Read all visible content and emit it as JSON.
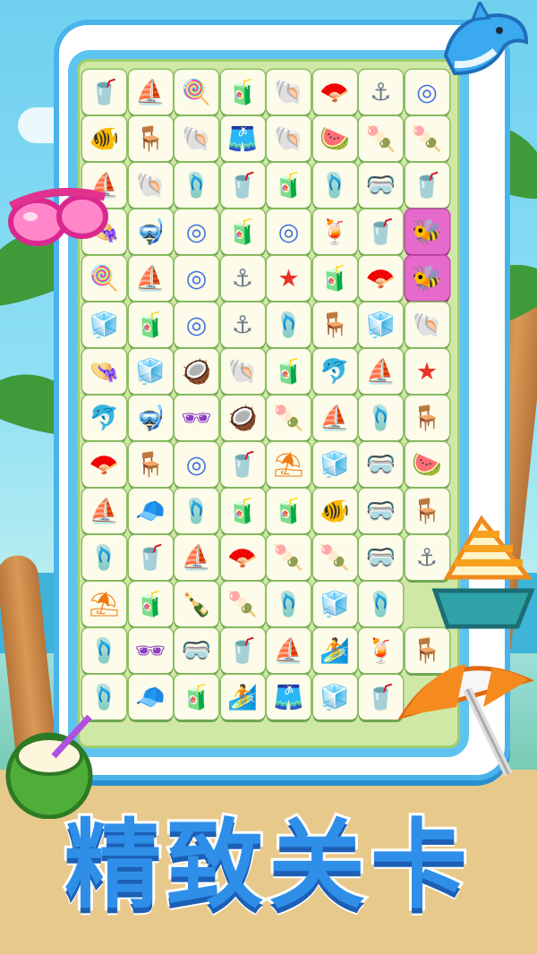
{
  "title": "精致关卡",
  "colors": {
    "board_frame": "#49b3ec",
    "board_bg": "#cfe8a6",
    "tile_bg": "#fdfbe9",
    "tile_selected": "#e56acb",
    "title_fill": "#2f8fe8"
  },
  "tiles": [
    [
      "lemonade-icon",
      "sailboat-icon",
      "candy-cane-icon",
      "juice-bottle-icon",
      "seashell-icon",
      "hand-fan-icon",
      "anchor-icon",
      "swim-ring-icon"
    ],
    [
      "tropical-fish-icon",
      "beach-chair-icon",
      "seashell-icon",
      "swim-shorts-icon",
      "seashell-icon",
      "watermelon-icon",
      "popsicle-icon",
      "popsicle-icon"
    ],
    [
      "sailboat-icon",
      "seashell-icon",
      "flip-flops-icon",
      "lemonade-icon",
      "juice-bottle-icon",
      "flip-flops-icon",
      "swim-goggles-icon",
      "lemonade-icon"
    ],
    [
      "sun-hat-icon",
      "diving-mask-icon",
      "swim-ring-icon",
      "juice-bottle-icon",
      "swim-ring-icon",
      "blue-drink-icon",
      "lemonade-icon",
      "bee-icon"
    ],
    [
      "candy-cane-icon",
      "sailboat-icon",
      "swim-ring-icon",
      "anchor-icon",
      "starfish-icon",
      "juice-bottle-icon",
      "hand-fan-icon",
      "bee-icon"
    ],
    [
      "ice-cubes-icon",
      "juice-bottle-icon",
      "swim-ring-icon",
      "anchor-icon",
      "flip-flops-icon",
      "beach-chair-icon",
      "ice-cubes-icon",
      "seashell-icon"
    ],
    [
      "sun-hat-icon",
      "ice-cubes-icon",
      "coconut-icon",
      "seashell-icon",
      "juice-bottle-icon",
      "dolphin-icon",
      "sailboat-icon",
      "starfish-icon"
    ],
    [
      "dolphin-icon",
      "diving-mask-icon",
      "sunglasses-icon",
      "coconut-icon",
      "popsicle-icon",
      "sailboat-icon",
      "flip-flops-icon",
      "beach-chair-icon"
    ],
    [
      "hand-fan-icon",
      "beach-chair-icon",
      "swim-ring-icon",
      "lemonade-icon",
      "beach-umbrella-icon",
      "ice-cubes-icon",
      "swim-goggles-icon",
      "watermelon-icon"
    ],
    [
      "sailboat-icon",
      "sun-visor-icon",
      "flip-flops-icon",
      "juice-bottle-icon",
      "juice-bottle-icon",
      "tropical-fish-icon",
      "swim-goggles-icon",
      "beach-chair-icon"
    ],
    [
      "flip-flops-icon",
      "lemonade-icon",
      "sailboat-icon",
      "hand-fan-icon",
      "popsicle-icon",
      "popsicle-icon",
      "swim-goggles-icon",
      "anchor-icon"
    ],
    [
      "beach-umbrella-icon",
      "juice-bottle-icon",
      "message-bottle-icon",
      "popsicle-icon",
      "flip-flops-icon",
      "ice-cubes-icon",
      "flip-flops-icon",
      "empty"
    ],
    [
      "flip-flops-icon",
      "sunglasses-icon",
      "swim-goggles-icon",
      "lemonade-icon",
      "sailboat-icon",
      "surfboard-icon",
      "blue-drink-icon",
      "beach-chair-icon"
    ],
    [
      "flip-flops-icon",
      "sun-visor-icon",
      "juice-bottle-icon",
      "surfboard-icon",
      "swim-shorts-icon",
      "ice-cubes-icon",
      "lemonade-icon",
      "empty"
    ]
  ],
  "selected": [
    [
      3,
      7
    ],
    [
      4,
      7
    ]
  ],
  "decorations": [
    "pink-goggles-icon",
    "dolphin-icon",
    "sailboat-icon",
    "beach-umbrella-icon",
    "coconut-drink-icon"
  ]
}
